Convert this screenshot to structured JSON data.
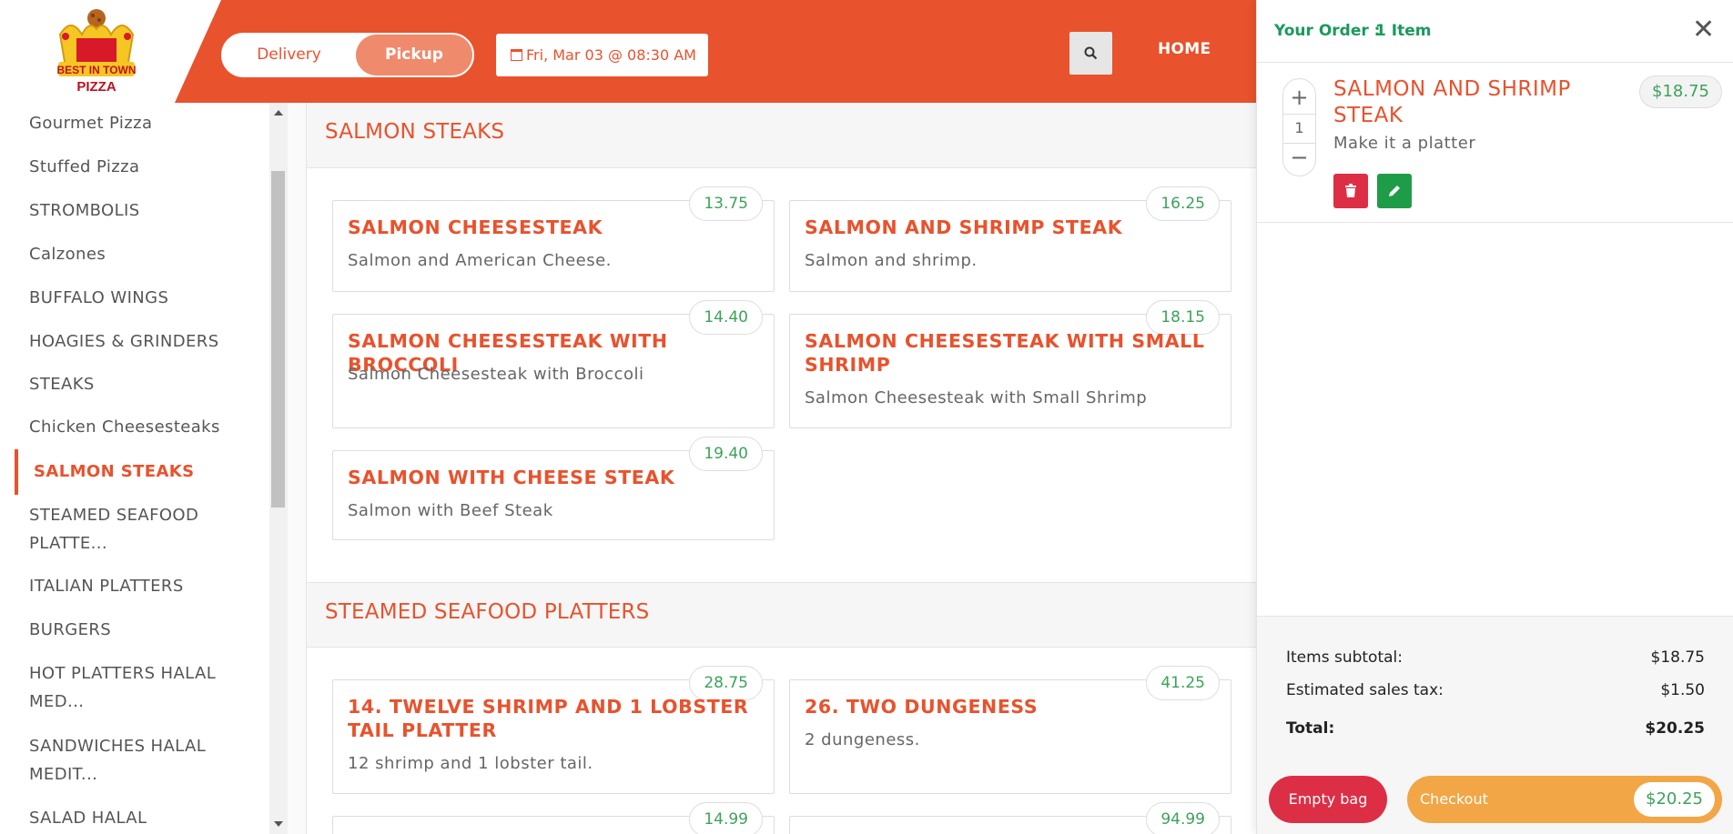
{
  "header": {
    "logo_text": "BEST IN TOWN PIZZA",
    "order_type": {
      "delivery": "Delivery",
      "pickup": "Pickup",
      "selected": "Pickup"
    },
    "datetime": "Fri, Mar 03 @ 08:30 AM",
    "nav_home": "HOME"
  },
  "sidebar": {
    "items": [
      {
        "label": "Gourmet Pizza"
      },
      {
        "label": "Stuffed Pizza"
      },
      {
        "label": "STROMBOLIS"
      },
      {
        "label": "Calzones"
      },
      {
        "label": "BUFFALO WINGS"
      },
      {
        "label": "HOAGIES & GRINDERS"
      },
      {
        "label": "STEAKS"
      },
      {
        "label": "Chicken Cheesesteaks"
      },
      {
        "label": "SALMON STEAKS"
      },
      {
        "label": "STEAMED SEAFOOD PLATTE..."
      },
      {
        "label": "ITALIAN PLATTERS"
      },
      {
        "label": "BURGERS"
      },
      {
        "label": "HOT PLATTERS HALAL MED..."
      },
      {
        "label": "SANDWICHES HALAL MEDIT..."
      },
      {
        "label": "SALAD HALAL"
      }
    ],
    "active": "SALMON STEAKS"
  },
  "sections": [
    {
      "title": "SALMON STEAKS",
      "items": [
        {
          "name": "SALMON CHEESESTEAK",
          "desc": "Salmon and American Cheese.",
          "price": "13.75"
        },
        {
          "name": "SALMON AND SHRIMP STEAK",
          "desc": "Salmon and shrimp.",
          "price": "16.25"
        },
        {
          "name": "SALMON CHEESESTEAK WITH BROCCOLI",
          "desc": "Salmon Cheesesteak with Broccoli",
          "price": "14.40"
        },
        {
          "name": "SALMON CHEESESTEAK WITH SMALL SHRIMP",
          "desc": "Salmon Cheesesteak with Small Shrimp",
          "price": "18.15"
        },
        {
          "name": "SALMON WITH CHEESE STEAK",
          "desc": "Salmon with Beef Steak",
          "price": "19.40"
        }
      ]
    },
    {
      "title": "STEAMED SEAFOOD PLATTERS",
      "items": [
        {
          "name": "14. TWELVE SHRIMP AND 1 LOBSTER TAIL PLATTER",
          "desc": "12 shrimp and 1 lobster tail.",
          "price": "28.75"
        },
        {
          "name": "26. TWO DUNGENESS",
          "desc": "2 dungeness.",
          "price": "41.25"
        },
        {
          "name": "",
          "desc": "",
          "price": "14.99"
        },
        {
          "name": "",
          "desc": "",
          "price": "94.99"
        }
      ]
    }
  ],
  "order": {
    "label": "Your Order :",
    "count": "1 Item",
    "item": {
      "qty": "1",
      "plus": "+",
      "minus": "−",
      "name": "SALMON AND SHRIMP STEAK",
      "modifier": "Make it a platter",
      "price": "$18.75"
    },
    "subtotal_label": "Items subtotal:",
    "subtotal": "$18.75",
    "tax_label": "Estimated sales tax:",
    "tax": "$1.50",
    "total_label": "Total:",
    "total": "$20.25",
    "empty_label": "Empty bag",
    "checkout_label": "Checkout",
    "checkout_amount": "$20.25",
    "close": "✕"
  },
  "colors": {
    "brand": "#e8522d",
    "price": "#3ca35a",
    "order_head": "#1a9a5c",
    "danger": "#dc2f45",
    "checkout": "#f2a645"
  },
  "icons": [
    "calendar-icon",
    "search-icon",
    "close-icon",
    "trash-icon",
    "pencil-icon"
  ]
}
